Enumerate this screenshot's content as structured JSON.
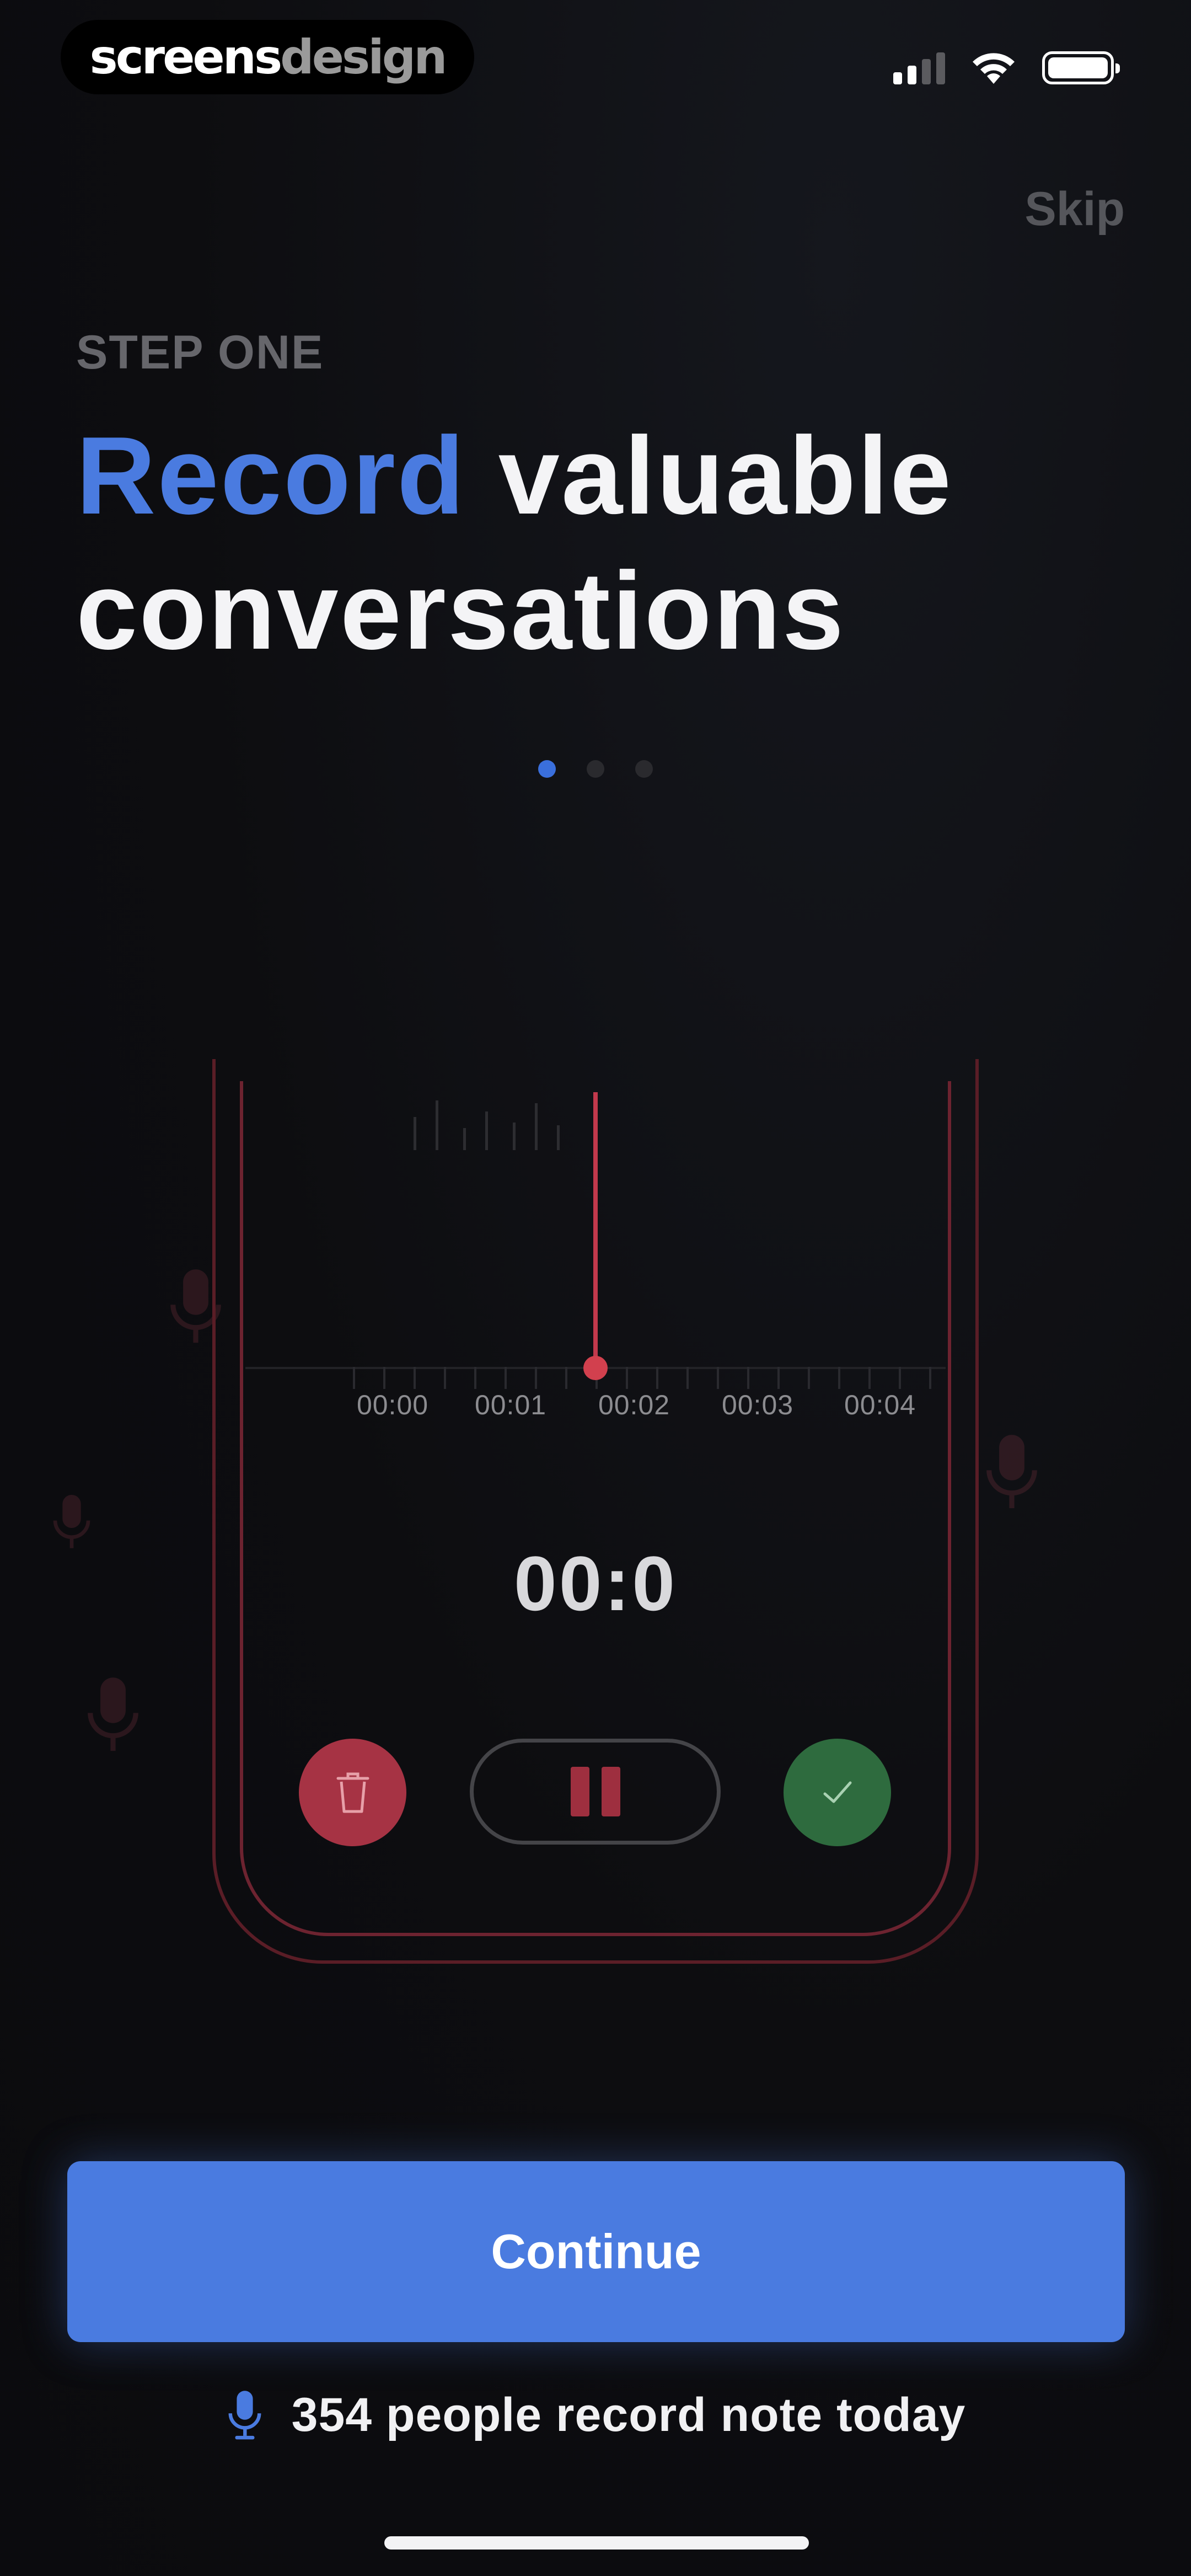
{
  "watermark": {
    "part_a": "screens",
    "part_b": "design"
  },
  "status_bar": {
    "signal_icon": "signal-icon",
    "wifi_icon": "wifi-icon",
    "battery_icon": "battery-icon"
  },
  "header": {
    "skip_label": "Skip"
  },
  "onboarding": {
    "step_label": "STEP ONE",
    "headline_accent": "Record",
    "headline_rest_line1": "valuable",
    "headline_line2": "conversations",
    "page_count": 3,
    "active_page": 1
  },
  "recorder": {
    "timeline_labels": [
      "00:00",
      "00:01",
      "00:02",
      "00:03",
      "00:04"
    ],
    "timer": "00:0",
    "delete_icon": "trash-icon",
    "pause_icon": "pause-icon",
    "confirm_icon": "checkmark-icon"
  },
  "cta": {
    "continue_label": "Continue"
  },
  "social_proof": {
    "icon": "microphone-icon",
    "text": "354 people record note today"
  },
  "colors": {
    "accent": "#4a7be0",
    "record_red": "#c2394c",
    "confirm_green": "#2e6b3e",
    "background": "#0d0d10"
  }
}
